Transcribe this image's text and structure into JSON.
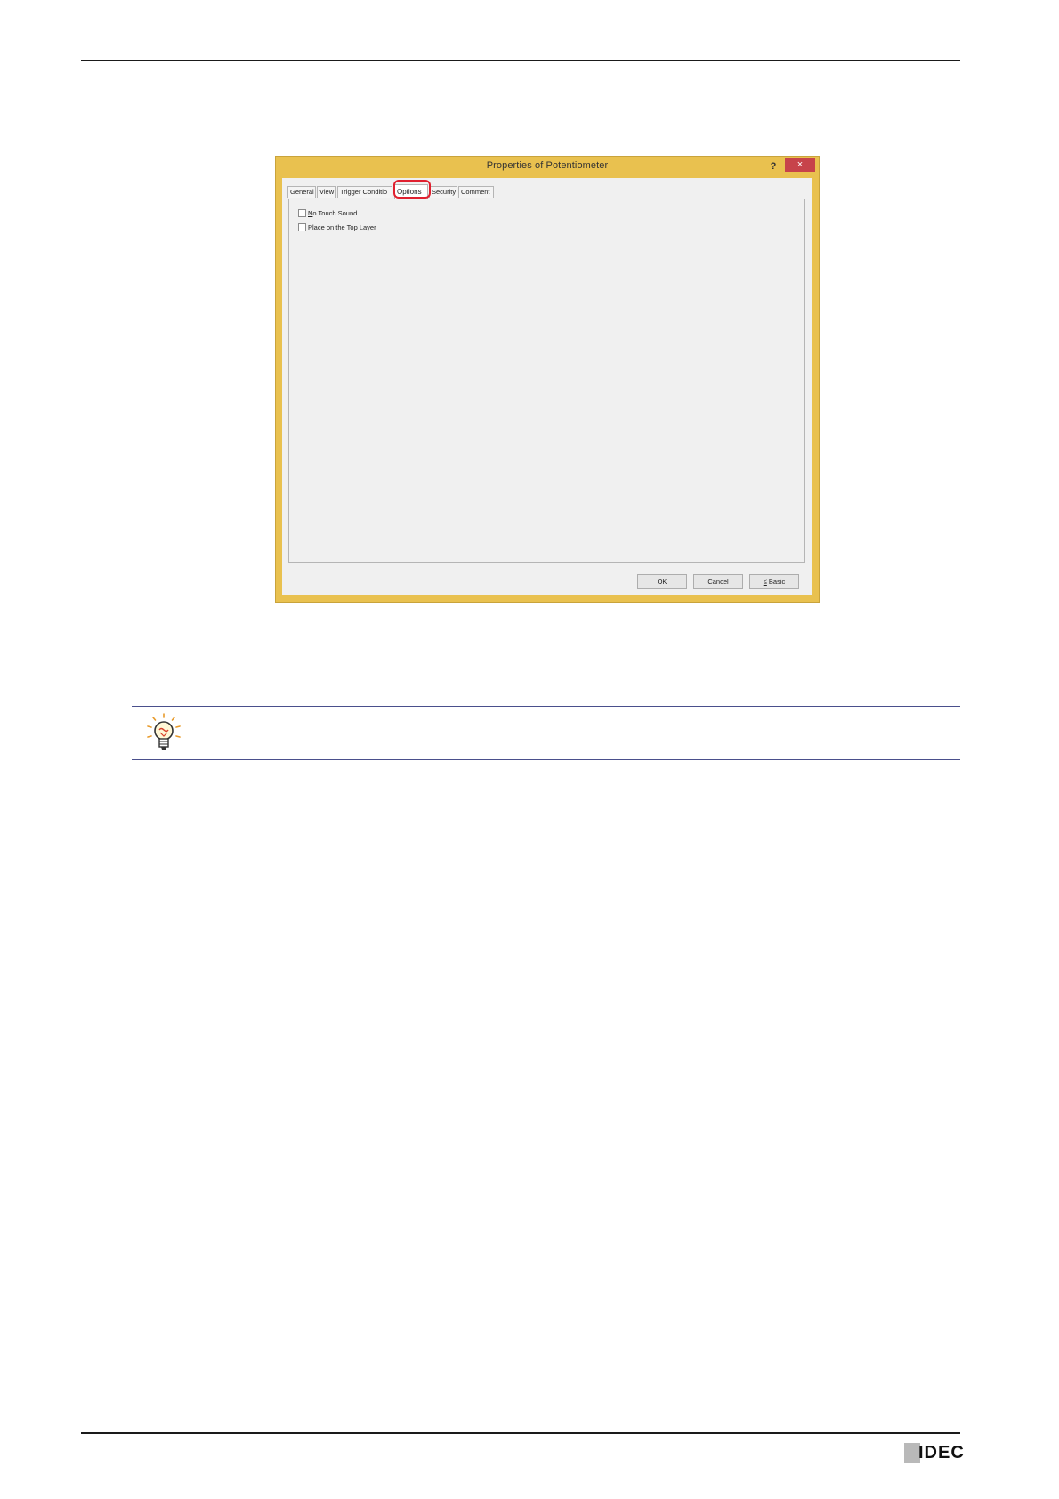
{
  "dialog": {
    "title": "Properties of Potentiometer",
    "help_label": "?",
    "close_label": "×",
    "tabs": [
      {
        "label": "General"
      },
      {
        "label": "View"
      },
      {
        "label": "Trigger Conditio"
      },
      {
        "label": "Options"
      },
      {
        "label": "Security"
      },
      {
        "label": "Comment"
      }
    ],
    "active_tab": "Options",
    "highlight_color": "#e0202f",
    "options": [
      {
        "accel": "N",
        "rest": "o Touch Sound",
        "checked": false
      },
      {
        "accel_pre": "Pl",
        "accel": "a",
        "rest": "ce on the Top Layer",
        "checked": false
      }
    ],
    "buttons": {
      "ok": "OK",
      "cancel": "Cancel",
      "basic_accel": "≤",
      "basic_rest": " Basic"
    }
  },
  "logo": {
    "text": "IDEC"
  },
  "colors": {
    "titlebar": "#e9c14f",
    "close_button": "#c7434a",
    "hint_rule": "#4a4f8c"
  }
}
